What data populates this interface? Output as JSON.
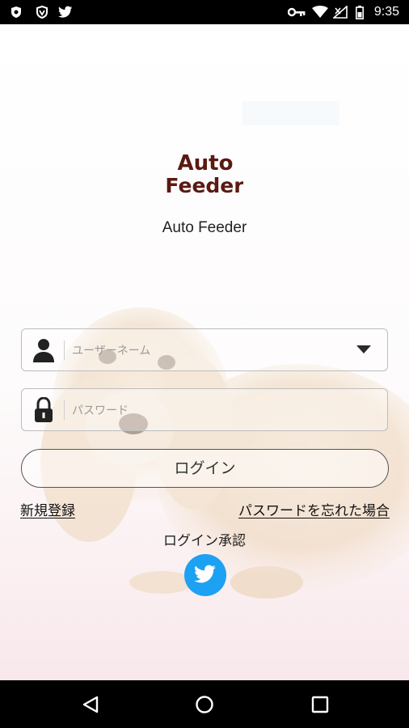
{
  "status_bar": {
    "time": "9:35",
    "left_icons": [
      "shield-icon",
      "vpn-shield-icon",
      "twitter-notification-icon"
    ],
    "right_icons": [
      "key-icon",
      "wifi-icon",
      "signal-icon",
      "battery-icon"
    ]
  },
  "app": {
    "logo_line1": "Auto",
    "logo_line2": "Feeder",
    "name": "Auto Feeder",
    "logo_color": "#5a1a12"
  },
  "login_form": {
    "username_placeholder": "ユーザーネーム",
    "password_placeholder": "パスワード",
    "login_button": "ログイン",
    "register_link": "新規登録",
    "forgot_password_link": "パスワードを忘れた場合",
    "approval_label": "ログイン承認",
    "twitter_color": "#1da1f2"
  },
  "nav_bar": {
    "buttons": [
      "back-icon",
      "home-icon",
      "recents-icon"
    ]
  }
}
